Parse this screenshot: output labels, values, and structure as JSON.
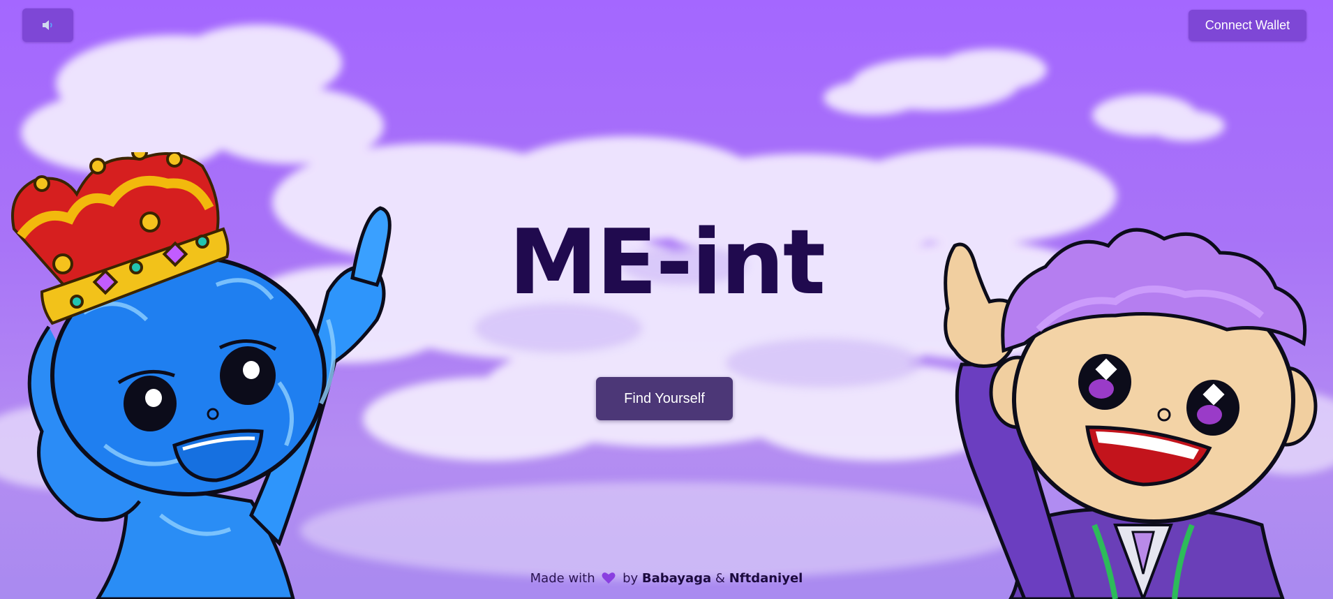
{
  "header": {
    "sound_button_icon": "speaker-icon",
    "connect_wallet_label": "Connect Wallet"
  },
  "hero": {
    "title": "ME-int",
    "cta_label": "Find Yourself"
  },
  "footer": {
    "made_with": "Made with",
    "heart_icon": "purple-heart-icon",
    "by": "by",
    "author_one": "Babayaga",
    "ampersand": "&",
    "author_two": "Nftdaniyel"
  },
  "colors": {
    "sky": "#a467ff",
    "button": "#7e47d6",
    "cta": "#4c3777",
    "title": "#200a4e"
  }
}
